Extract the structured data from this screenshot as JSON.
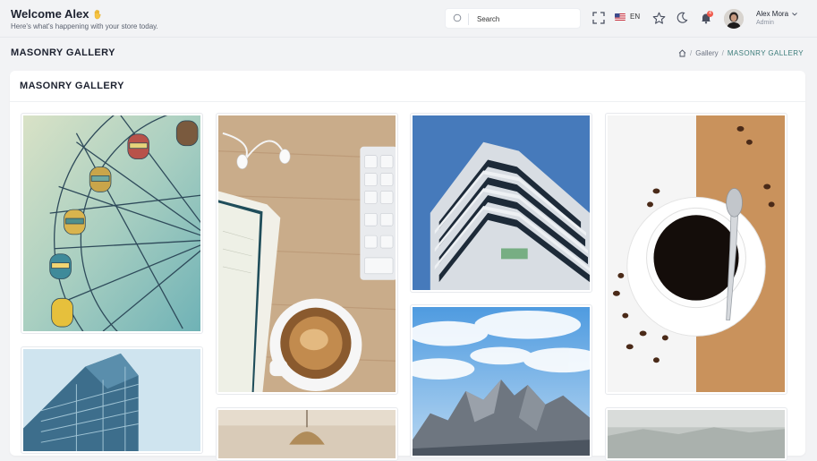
{
  "header": {
    "welcome_title": "Welcome Alex",
    "welcome_sub": "Here's what's happening with your store today.",
    "search_placeholder": "Search",
    "language": "EN",
    "notification_count": "4",
    "user_name": "Alex Mora",
    "user_role": "Admin"
  },
  "page": {
    "title": "MASONRY GALLERY",
    "breadcrumb": [
      "Gallery",
      "MASONRY GALLERY"
    ]
  },
  "card": {
    "title": "MASONRY GALLERY"
  },
  "gallery": [
    {
      "name": "ferris-wheel-image",
      "subject": "ferris wheel"
    },
    {
      "name": "coffee-desk-image",
      "subject": "coffee, notebook, earphones and keyboard on desk"
    },
    {
      "name": "balcony-building-image",
      "subject": "modern building with balconies"
    },
    {
      "name": "coffee-cup-image",
      "subject": "cup of black coffee with spoon"
    },
    {
      "name": "glass-building-image",
      "subject": "glass office building"
    },
    {
      "name": "mountains-image",
      "subject": "rocky mountain peaks under clouds"
    },
    {
      "name": "pendant-lamp-image",
      "subject": "pendant lamp"
    },
    {
      "name": "foggy-landscape-image",
      "subject": "foggy landscape"
    }
  ],
  "colors": {
    "accent": "#3c7c7a",
    "badge": "#f05a4c",
    "background": "#f2f3f5"
  }
}
